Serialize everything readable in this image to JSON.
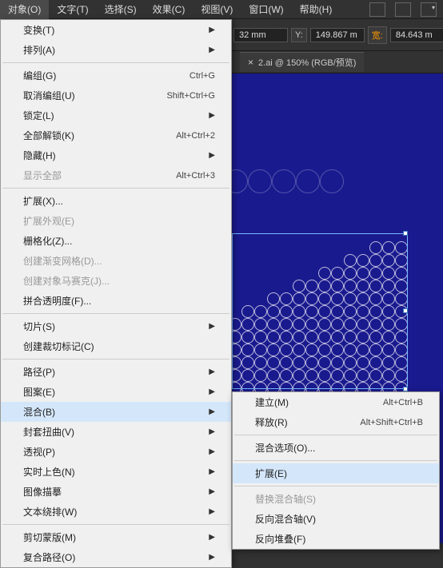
{
  "menubar": {
    "items": [
      {
        "label": "对象(O)",
        "active": true
      },
      {
        "label": "文字(T)"
      },
      {
        "label": "选择(S)"
      },
      {
        "label": "效果(C)"
      },
      {
        "label": "视图(V)"
      },
      {
        "label": "窗口(W)"
      },
      {
        "label": "帮助(H)"
      }
    ]
  },
  "toolbar": {
    "x_unit": "32 mm",
    "y_label": "Y:",
    "y_value": "149.867 m",
    "w_label": "宽:",
    "w_value": "84.643 m"
  },
  "tab": {
    "title": "2.ai @ 150% (RGB/预览)",
    "close": "×"
  },
  "dropdown": {
    "groups": [
      [
        {
          "label": "变换(T)",
          "arrow": true
        },
        {
          "label": "排列(A)",
          "arrow": true
        }
      ],
      [
        {
          "label": "编组(G)",
          "shortcut": "Ctrl+G"
        },
        {
          "label": "取消编组(U)",
          "shortcut": "Shift+Ctrl+G"
        },
        {
          "label": "锁定(L)",
          "arrow": true
        },
        {
          "label": "全部解锁(K)",
          "shortcut": "Alt+Ctrl+2"
        },
        {
          "label": "隐藏(H)",
          "arrow": true
        },
        {
          "label": "显示全部",
          "shortcut": "Alt+Ctrl+3",
          "disabled": true
        }
      ],
      [
        {
          "label": "扩展(X)..."
        },
        {
          "label": "扩展外观(E)",
          "disabled": true
        },
        {
          "label": "栅格化(Z)..."
        },
        {
          "label": "创建渐变网格(D)...",
          "disabled": true
        },
        {
          "label": "创建对象马赛克(J)...",
          "disabled": true
        },
        {
          "label": "拼合透明度(F)..."
        }
      ],
      [
        {
          "label": "切片(S)",
          "arrow": true
        },
        {
          "label": "创建裁切标记(C)"
        }
      ],
      [
        {
          "label": "路径(P)",
          "arrow": true
        },
        {
          "label": "图案(E)",
          "arrow": true
        },
        {
          "label": "混合(B)",
          "arrow": true,
          "highlighted": true
        },
        {
          "label": "封套扭曲(V)",
          "arrow": true
        },
        {
          "label": "透视(P)",
          "arrow": true
        },
        {
          "label": "实时上色(N)",
          "arrow": true
        },
        {
          "label": "图像描摹",
          "arrow": true
        },
        {
          "label": "文本绕排(W)",
          "arrow": true
        }
      ],
      [
        {
          "label": "剪切蒙版(M)",
          "arrow": true
        },
        {
          "label": "复合路径(O)",
          "arrow": true
        }
      ]
    ]
  },
  "submenu": {
    "groups": [
      [
        {
          "label": "建立(M)",
          "shortcut": "Alt+Ctrl+B"
        },
        {
          "label": "释放(R)",
          "shortcut": "Alt+Shift+Ctrl+B"
        }
      ],
      [
        {
          "label": "混合选项(O)..."
        }
      ],
      [
        {
          "label": "扩展(E)",
          "highlighted": true
        }
      ],
      [
        {
          "label": "替换混合轴(S)",
          "disabled": true
        },
        {
          "label": "反向混合轴(V)"
        },
        {
          "label": "反向堆叠(F)"
        }
      ]
    ]
  }
}
